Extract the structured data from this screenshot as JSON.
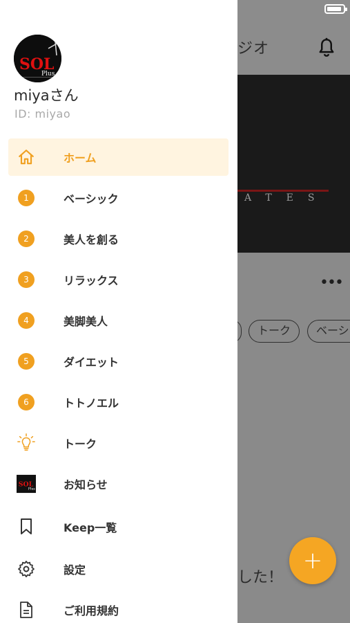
{
  "background": {
    "header_title": "ジオ",
    "banner_text": "ATES",
    "chips": [
      "",
      "トーク",
      "ベーシ"
    ],
    "bottom_text": "した！"
  },
  "drawer": {
    "user_name": "miyaさん",
    "user_id": "ID: miyao",
    "logo_text": "SOL",
    "logo_sub": "Plus",
    "menu": [
      {
        "label": "ホーム",
        "icon": "home-icon",
        "active": true
      },
      {
        "label": "ベーシック",
        "icon": "number-badge",
        "number": "1"
      },
      {
        "label": "美人を創る",
        "icon": "number-badge",
        "number": "2"
      },
      {
        "label": "リラックス",
        "icon": "number-badge",
        "number": "3"
      },
      {
        "label": "美脚美人",
        "icon": "number-badge",
        "number": "4"
      },
      {
        "label": "ダイエット",
        "icon": "number-badge",
        "number": "5"
      },
      {
        "label": "トトノエル",
        "icon": "number-badge",
        "number": "6"
      },
      {
        "label": "トーク",
        "icon": "lightbulb-icon"
      },
      {
        "label": "お知らせ",
        "icon": "sol-logo-icon"
      },
      {
        "label": "Keep一覧",
        "icon": "bookmark-icon"
      },
      {
        "label": "設定",
        "icon": "gear-icon"
      },
      {
        "label": "ご利用規約",
        "icon": "document-icon"
      }
    ]
  },
  "fab": {
    "symbol": "+"
  },
  "colors": {
    "accent": "#f0a020",
    "active_bg": "#fff4e0",
    "overlay": "#8a8a8a"
  }
}
